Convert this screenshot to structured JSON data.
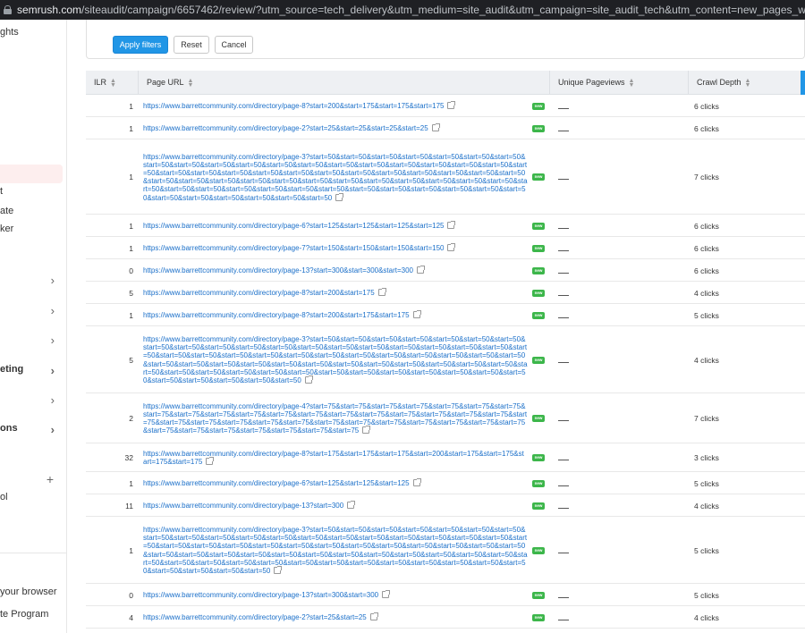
{
  "browser": {
    "host": "semrush.com",
    "path": "/siteaudit/campaign/6657462/review/?utm_source=tech_delivery&utm_medium=site_audit&utm_campaign=site_audit_tech&utm_content=new_pages_with_issues&utm_term=new_pag"
  },
  "sidebar": {
    "items": [
      {
        "label": "ghts",
        "chevron": false,
        "bold": false
      },
      {
        "label": "t",
        "chevron": false,
        "bold": false
      },
      {
        "label": "ate",
        "chevron": false,
        "bold": false
      },
      {
        "label": "ker",
        "chevron": false,
        "bold": false
      },
      {
        "label": "",
        "chevron": true,
        "bold": false
      },
      {
        "label": "",
        "chevron": true,
        "bold": false
      },
      {
        "label": "",
        "chevron": true,
        "bold": false
      },
      {
        "label": "eting",
        "chevron": true,
        "bold": true
      },
      {
        "label": "",
        "chevron": true,
        "bold": false
      },
      {
        "label": "ons",
        "chevron": true,
        "bold": true
      },
      {
        "label": "ol",
        "chevron": false,
        "bold": false
      },
      {
        "label": "your browser",
        "chevron": false,
        "bold": false
      },
      {
        "label": "te Program",
        "chevron": false,
        "bold": false
      }
    ],
    "plus_icon": "+"
  },
  "filters": {
    "apply_label": "Apply filters",
    "reset_label": "Reset",
    "cancel_label": "Cancel"
  },
  "table": {
    "columns": [
      "ILR",
      "Page URL",
      "Unique Pageviews",
      "Crawl Depth"
    ],
    "new_badge": "new",
    "rows": [
      {
        "ilr": "1",
        "url": "https://www.barrettcommunity.com/directory/page-8?start=200&start=175&start=175&start=175",
        "depth": "6 clicks"
      },
      {
        "ilr": "1",
        "url": "https://www.barrettcommunity.com/directory/page-2?start=25&start=25&start=25&start=25",
        "depth": "6 clicks"
      },
      {
        "ilr": "1",
        "url": "https://www.barrettcommunity.com/directory/page-3?start=50&start=50&start=50&start=50&start=50&start=50&start=50&start=50&start=50&start=50&start=50&start=50&start=50&start=50&start=50&start=50&start=50&start=50&start=50&start=50&start=50&start=50&start=50&start=50&start=50&start=50&start=50&start=50&start=50&start=50&start=50&start=50&start=50&start=50&start=50&start=50&start=50&start=50&start=50&start=50&start=50&start=50&start=50&start=50&start=50&start=50&start=50&start=50&start=50&start=50&start=50&start=50&start=50&start=50&start=50&start=50&start=50&start=50&start=50&start=50&start=50&start=50&start=50",
        "depth": "7 clicks"
      },
      {
        "ilr": "1",
        "url": "https://www.barrettcommunity.com/directory/page-6?start=125&start=125&start=125&start=125",
        "depth": "6 clicks"
      },
      {
        "ilr": "1",
        "url": "https://www.barrettcommunity.com/directory/page-7?start=150&start=150&start=150&start=150",
        "depth": "6 clicks"
      },
      {
        "ilr": "0",
        "url": "https://www.barrettcommunity.com/directory/page-13?start=300&start=300&start=300",
        "depth": "6 clicks"
      },
      {
        "ilr": "5",
        "url": "https://www.barrettcommunity.com/directory/page-8?start=200&start=175",
        "depth": "4 clicks"
      },
      {
        "ilr": "1",
        "url": "https://www.barrettcommunity.com/directory/page-8?start=200&start=175&start=175",
        "depth": "5 clicks"
      },
      {
        "ilr": "5",
        "url": "https://www.barrettcommunity.com/directory/page-3?start=50&start=50&start=50&start=50&start=50&start=50&start=50&start=50&start=50&start=50&start=50&start=50&start=50&start=50&start=50&start=50&start=50&start=50&start=50&start=50&start=50&start=50&start=50&start=50&start=50&start=50&start=50&start=50&start=50&start=50&start=50&start=50&start=50&start=50&start=50&start=50&start=50&start=50&start=50&start=50&start=50&start=50&start=50&start=50&start=50&start=50&start=50&start=50&start=50&start=50&start=50&start=50&start=50&start=50&start=50&start=50&start=50&start=50&start=50&start=50&start=50&start=50",
        "depth": "4 clicks"
      },
      {
        "ilr": "2",
        "url": "https://www.barrettcommunity.com/directory/page-4?start=75&start=75&start=75&start=75&start=75&start=75&start=75&start=75&start=75&start=75&start=75&start=75&start=75&start=75&start=75&start=75&start=75&start=75&start=75&start=75&start=75&start=75&start=75&start=75&start=75&start=75&start=75&start=75&start=75&start=75&start=75&start=75&start=75&start=75&start=75&start=75&start=75&start=75&start=75",
        "depth": "7 clicks"
      },
      {
        "ilr": "32",
        "url": "https://www.barrettcommunity.com/directory/page-8?start=175&start=175&start=175&start=200&start=175&start=175&start=175&start=175",
        "depth": "3 clicks"
      },
      {
        "ilr": "1",
        "url": "https://www.barrettcommunity.com/directory/page-6?start=125&start=125&start=125",
        "depth": "5 clicks"
      },
      {
        "ilr": "11",
        "url": "https://www.barrettcommunity.com/directory/page-13?start=300",
        "depth": "4 clicks"
      },
      {
        "ilr": "1",
        "url": "https://www.barrettcommunity.com/directory/page-3?start=50&start=50&start=50&start=50&start=50&start=50&start=50&start=50&start=50&start=50&start=50&start=50&start=50&start=50&start=50&start=50&start=50&start=50&start=50&start=50&start=50&start=50&start=50&start=50&start=50&start=50&start=50&start=50&start=50&start=50&start=50&start=50&start=50&start=50&start=50&start=50&start=50&start=50&start=50&start=50&start=50&start=50&start=50&start=50&start=50&start=50&start=50&start=50&start=50&start=50&start=50&start=50&start=50&start=50&start=50&start=50&start=50&start=50&start=50&start=50&start=50",
        "depth": "5 clicks"
      },
      {
        "ilr": "0",
        "url": "https://www.barrettcommunity.com/directory/page-13?start=300&start=300",
        "depth": "5 clicks"
      },
      {
        "ilr": "4",
        "url": "https://www.barrettcommunity.com/directory/page-2?start=25&start=25",
        "depth": "4 clicks"
      }
    ]
  }
}
